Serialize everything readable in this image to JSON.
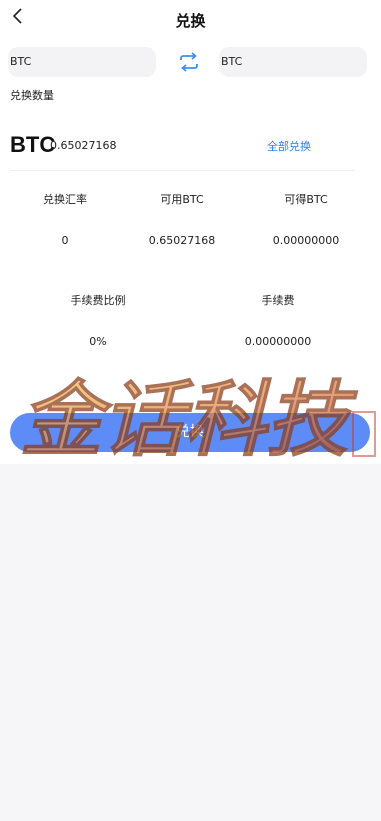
{
  "header": {
    "title": "兑换",
    "back_icon": "chevron-left-icon"
  },
  "swap": {
    "from_coin": "BTC",
    "to_coin": "BTC",
    "swap_icon": "swap-arrows-icon",
    "accent": "#3f8ef0"
  },
  "amount": {
    "label": "兑换数量",
    "coin": "BTC",
    "value": "0.65027168",
    "all_label": "全部兑换"
  },
  "stats_row1": [
    {
      "label": "兑换汇率",
      "value": "0"
    },
    {
      "label": "可用BTC",
      "value": "0.65027168"
    },
    {
      "label": "可得BTC",
      "value": "0.00000000"
    }
  ],
  "stats_row2": [
    {
      "label": "手续费比例",
      "value": "0%"
    },
    {
      "label": "手续费",
      "value": "0.00000000"
    }
  ],
  "submit": {
    "label": "兑换",
    "color": "#5e8cf7"
  },
  "watermark": {
    "text": "金话科技"
  }
}
